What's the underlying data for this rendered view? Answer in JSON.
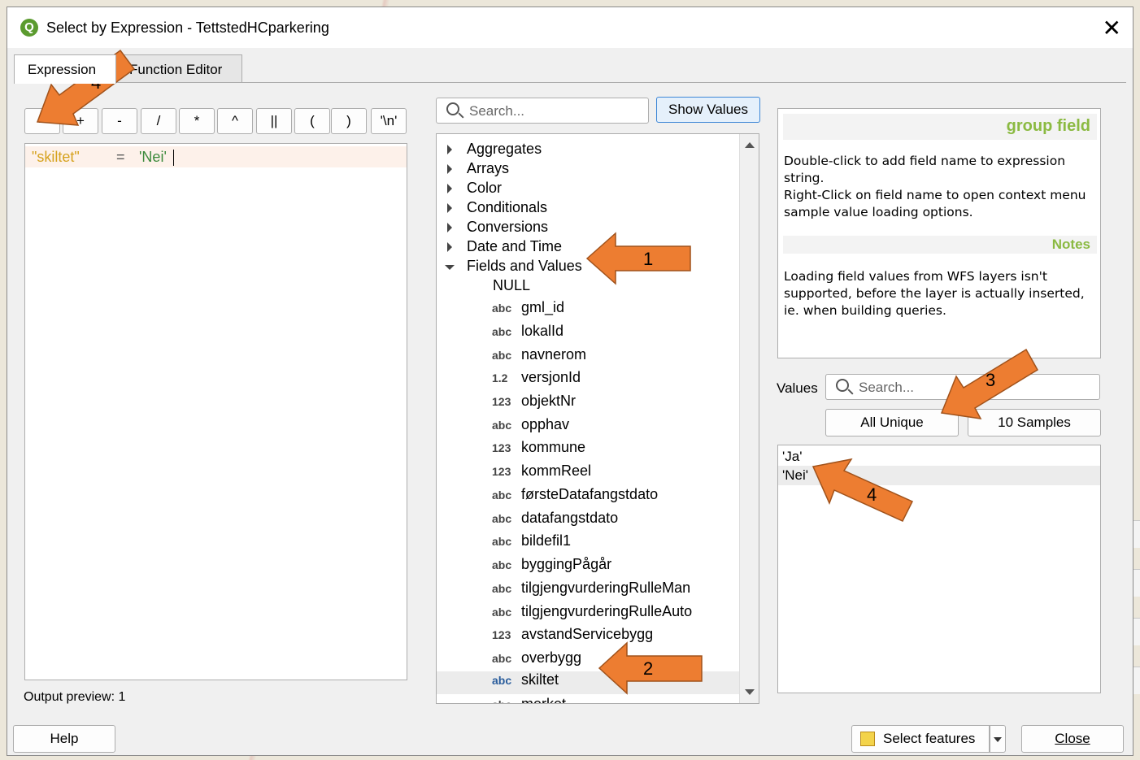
{
  "window": {
    "title": "Select by Expression - TettstedHCparkering",
    "close": "✕"
  },
  "tabs": [
    "Expression",
    "Function Editor"
  ],
  "operators": [
    "=",
    "+",
    "-",
    "/",
    "*",
    "^",
    "||",
    "(",
    ")",
    "'\\n'"
  ],
  "expression": {
    "field": "\"skiltet\"",
    "op": "=",
    "value": "'Nei'"
  },
  "output_preview": "Output preview:  1",
  "help_button": "Help",
  "function_search": {
    "placeholder": "Search...",
    "show_values": "Show Values"
  },
  "tree": {
    "groups": [
      "Aggregates",
      "Arrays",
      "Color",
      "Conditionals",
      "Conversions",
      "Date and Time",
      "Fields and Values"
    ],
    "null_item": "NULL",
    "fields": [
      {
        "type": "abc",
        "name": "gml_id"
      },
      {
        "type": "abc",
        "name": "lokalId"
      },
      {
        "type": "abc",
        "name": "navnerom"
      },
      {
        "type": "1.2",
        "name": "versjonId"
      },
      {
        "type": "123",
        "name": "objektNr"
      },
      {
        "type": "abc",
        "name": "opphav"
      },
      {
        "type": "123",
        "name": "kommune"
      },
      {
        "type": "123",
        "name": "kommReel"
      },
      {
        "type": "abc",
        "name": "førsteDatafangstdato"
      },
      {
        "type": "abc",
        "name": "datafangstdato"
      },
      {
        "type": "abc",
        "name": "bildefil1"
      },
      {
        "type": "abc",
        "name": "byggingPågår"
      },
      {
        "type": "abc",
        "name": "tilgjengvurderingRulleMan"
      },
      {
        "type": "abc",
        "name": "tilgjengvurderingRulleAuto"
      },
      {
        "type": "123",
        "name": "avstandServicebygg"
      },
      {
        "type": "abc",
        "name": "overbygg"
      },
      {
        "type": "abc",
        "name": "skiltet"
      },
      {
        "type": "abc",
        "name": "merket"
      }
    ]
  },
  "help_panel": {
    "title": "group field",
    "text1": "Double-click to add field name to expression string.",
    "text2": "Right-Click on field name to open context menu sample value loading options.",
    "notes_title": "Notes",
    "notes": "Loading field values from WFS layers isn't supported, before the layer is actually inserted, ie. when building queries."
  },
  "values": {
    "label": "Values",
    "placeholder": "Search...",
    "all_unique": "All Unique",
    "samples": "10 Samples",
    "items": [
      "'Ja'",
      "'Nei'"
    ]
  },
  "footer": {
    "select_features": "Select features",
    "close": "Close"
  },
  "annotations": [
    "1",
    "2",
    "3",
    "4",
    "4"
  ],
  "colors": {
    "arrow_fill": "#ed7d31",
    "help_title": "#8bba42",
    "expr_field": "#d6a21e",
    "expr_string": "#3c8a3c"
  }
}
